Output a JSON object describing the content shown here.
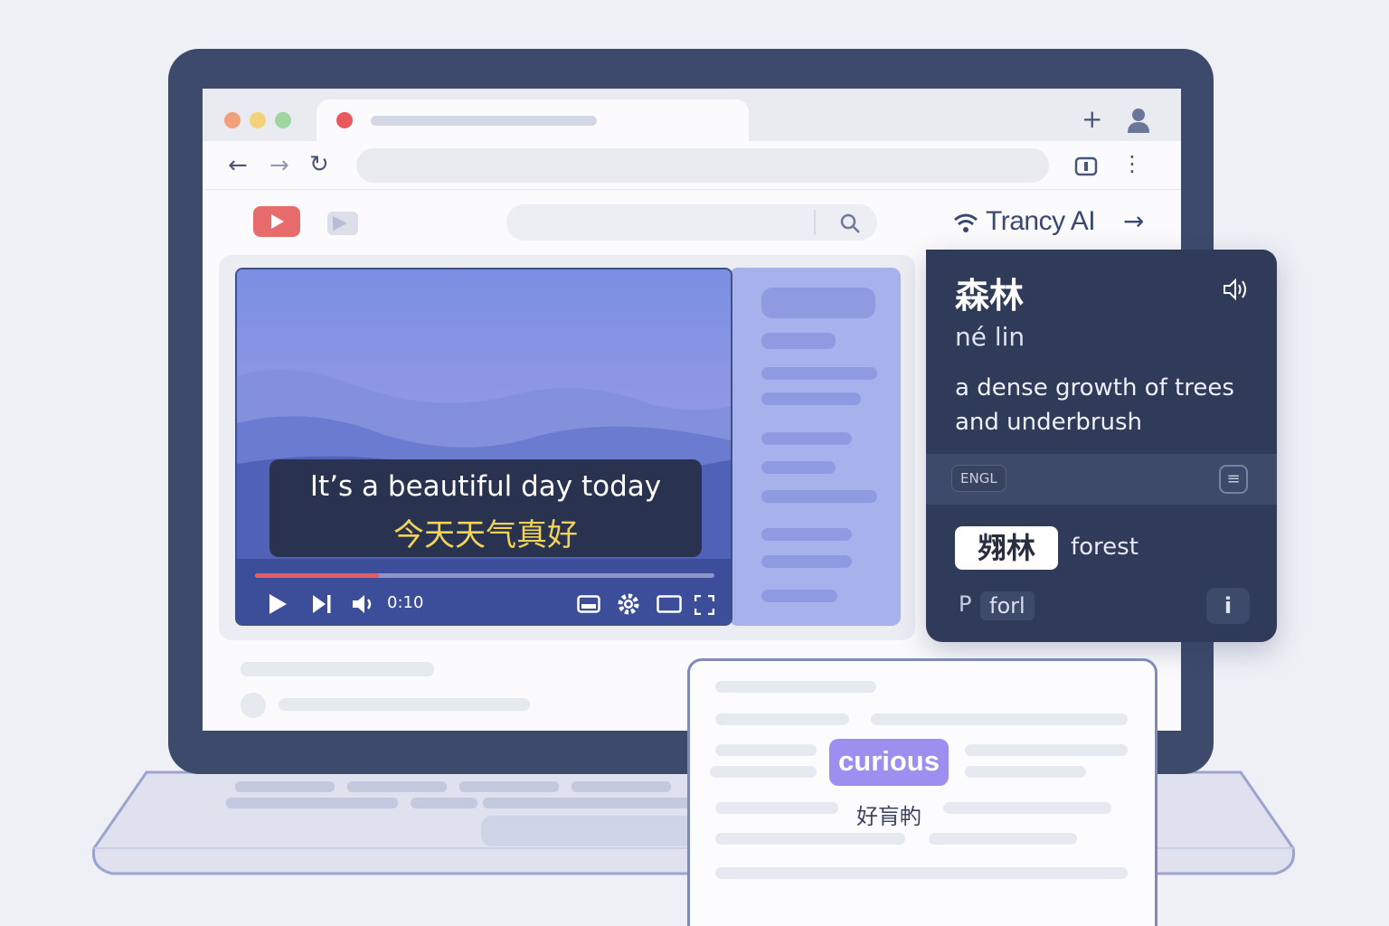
{
  "browser": {
    "traffic_lights": [
      "#f2a07b",
      "#f4d278",
      "#9fd6a0"
    ],
    "tab_favicon_color": "#e8585c",
    "nav_icons": [
      "back-arrow-icon",
      "forward-arrow-icon",
      "reload-icon"
    ],
    "toolbar_icons": [
      "new-tab-icon",
      "profile-icon",
      "reader-icon",
      "more-menu-icon"
    ]
  },
  "video": {
    "subtitle_en": "It’s a beautiful day today",
    "subtitle_zh": "今天天气真好",
    "progress": 0.27,
    "time": "0:10"
  },
  "trancy": {
    "title": "Trancy AI",
    "word": "森林",
    "pinyin": "né lin",
    "definition": "a dense growth of trees and underbrush",
    "language": "ENGL",
    "example_word": "翙林",
    "translation": "forest",
    "p_label": "P",
    "for_chip": "forl"
  },
  "document": {
    "highlight_word": "curious",
    "highlight_translation": "好肓畃"
  },
  "colors": {
    "accent": "#3d4a6b",
    "card": "#2f3b59",
    "highlight": "#9c8ff0",
    "subtitle_zh": "#f1d35a",
    "progress": "#e45b63"
  }
}
